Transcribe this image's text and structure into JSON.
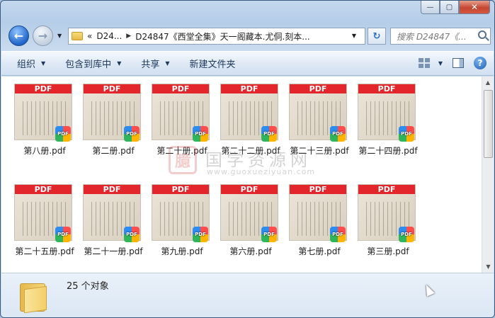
{
  "window": {
    "caption_buttons": [
      "—",
      "▢",
      "✕"
    ]
  },
  "nav": {
    "history_glyph": "▼",
    "address": {
      "prefix": "«",
      "crumb1": "D24...",
      "sep": "▶",
      "crumb2": "D24847《西堂全集》天一阁藏本.尤侗.刻本...",
      "dropdown": "▼"
    },
    "refresh_glyph": "↻",
    "search_placeholder": "搜索 D24847《..."
  },
  "toolbar": {
    "organize": "组织",
    "include_library": "包含到库中",
    "share": "共享",
    "new_folder": "新建文件夹",
    "caret": "▼"
  },
  "files": [
    {
      "name": "第八册.pdf"
    },
    {
      "name": "第二册.pdf"
    },
    {
      "name": "第二十册.pdf"
    },
    {
      "name": "第二十二册.pdf"
    },
    {
      "name": "第二十三册.pdf"
    },
    {
      "name": "第二十四册.pdf"
    },
    {
      "name": "第二十五册.pdf"
    },
    {
      "name": "第二十一册.pdf"
    },
    {
      "name": "第九册.pdf"
    },
    {
      "name": "第六册.pdf"
    },
    {
      "name": "第七册.pdf"
    },
    {
      "name": "第三册.pdf"
    }
  ],
  "thumbnail_band": "PDF",
  "watermark": {
    "seal": "臆",
    "text": "国学资源网",
    "url": "www.guoxueziyuan.com"
  },
  "status": {
    "count": "25 个对象"
  },
  "icons": {
    "back": "back-arrow-icon",
    "forward": "forward-arrow-icon",
    "help": "?"
  }
}
